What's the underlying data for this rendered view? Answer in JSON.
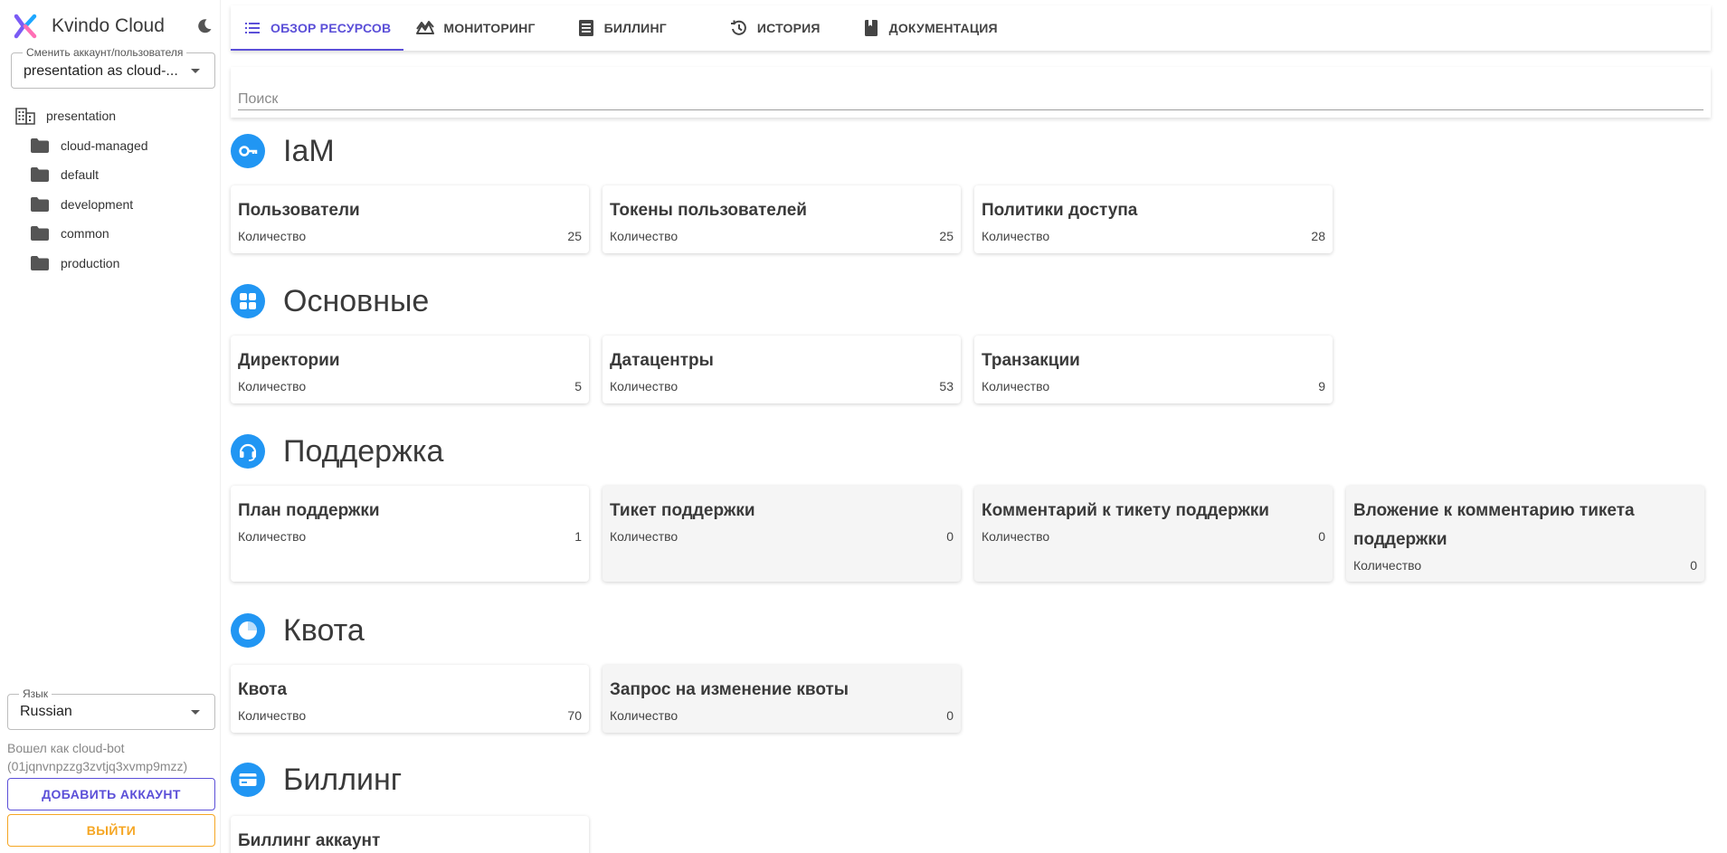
{
  "app": {
    "title": "Kvindo Cloud"
  },
  "account_select": {
    "label": "Сменить аккаунт/пользователя",
    "value": "presentation as cloud-..."
  },
  "tree": {
    "root": "presentation",
    "children": [
      "cloud-managed",
      "default",
      "development",
      "common",
      "production"
    ]
  },
  "language": {
    "label": "Язык",
    "value": "Russian"
  },
  "login_info": {
    "line1": "Вошел как cloud-bot",
    "line2": "(01jqnvnpzzg3zvtjq3xvmp9mzz)"
  },
  "buttons": {
    "add_account": "ДОБАВИТЬ АККАУНТ",
    "logout": "ВЫЙТИ"
  },
  "tabs": [
    {
      "label": "ОБЗОР РЕСУРСОВ",
      "icon": "list-icon",
      "active": true
    },
    {
      "label": "МОНИТОРИНГ",
      "icon": "monitoring-icon",
      "active": false
    },
    {
      "label": "БИЛЛИНГ",
      "icon": "billing-icon",
      "active": false
    },
    {
      "label": "ИСТОРИЯ",
      "icon": "history-icon",
      "active": false
    },
    {
      "label": "ДОКУМЕНТАЦИЯ",
      "icon": "book-icon",
      "active": false
    }
  ],
  "search": {
    "placeholder": "Поиск"
  },
  "count_label": "Количество",
  "sections": [
    {
      "title": "IaM",
      "icon": "key-icon",
      "cards": [
        {
          "title": "Пользователи",
          "count": "25"
        },
        {
          "title": "Токены пользователей",
          "count": "25"
        },
        {
          "title": "Политики доступа",
          "count": "28"
        }
      ]
    },
    {
      "title": "Основные",
      "icon": "grid-icon",
      "cards": [
        {
          "title": "Директории",
          "count": "5"
        },
        {
          "title": "Датацентры",
          "count": "53"
        },
        {
          "title": "Транзакции",
          "count": "9"
        }
      ]
    },
    {
      "title": "Поддержка",
      "icon": "headset-icon",
      "cards": [
        {
          "title": "План поддержки",
          "count": "1"
        },
        {
          "title": "Тикет поддержки",
          "count": "0"
        },
        {
          "title": "Комментарий к тикету поддержки",
          "count": "0"
        },
        {
          "title": "Вложение к комментарию тикета поддержки",
          "count": "0"
        }
      ]
    },
    {
      "title": "Квота",
      "icon": "pie-icon",
      "cards": [
        {
          "title": "Квота",
          "count": "70"
        },
        {
          "title": "Запрос на изменение квоты",
          "count": "0"
        }
      ]
    },
    {
      "title": "Биллинг",
      "icon": "credit-card-icon",
      "cards": [
        {
          "title": "Биллинг аккаунт"
        }
      ]
    }
  ],
  "colors": {
    "accent": "#5b4fd8",
    "section_icon": "#2196f3",
    "logout": "#f5a623"
  }
}
